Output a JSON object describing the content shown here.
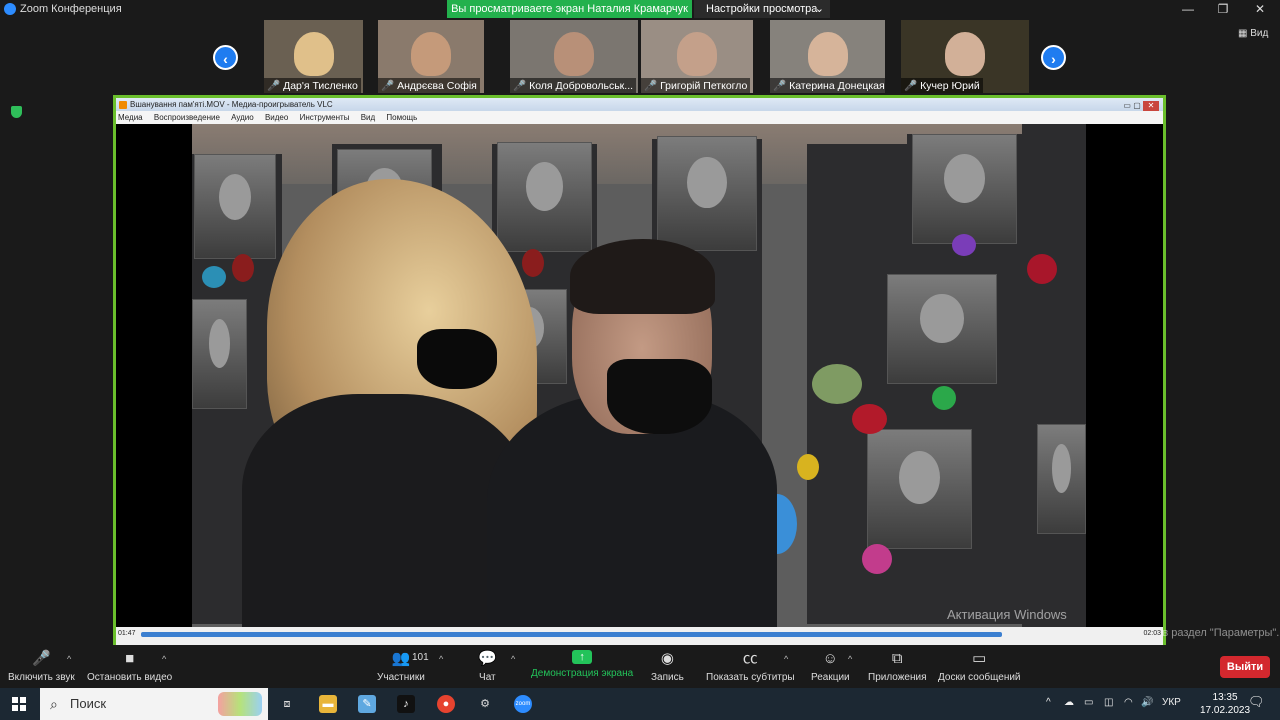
{
  "window": {
    "app_title": "Zoom Конференция"
  },
  "share_banner": "Вы просматриваете экран Наталия Крамарчук",
  "view_settings": "Настройки просмотра",
  "view_button": "Вид",
  "participants": [
    {
      "name": "Дар'я Тисленко"
    },
    {
      "name": "Андрєєва Софія"
    },
    {
      "name": "Коля Добровольськ..."
    },
    {
      "name": "Григорій Петкогло"
    },
    {
      "name": "Катерина Донецкая"
    },
    {
      "name": "Кучер Юрий"
    }
  ],
  "vlc": {
    "title": "Вшанування пам'яті.MOV - Медиа-проигрыватель VLC",
    "menu": [
      "Медиа",
      "Воспроизведение",
      "Аудио",
      "Видео",
      "Инструменты",
      "Вид",
      "Помощь"
    ],
    "time_elapsed": "01:47",
    "time_total": "02:03",
    "progress": 0.87
  },
  "windows_watermark": {
    "line1": "Активация Windows",
    "line2": "Чтобы активировать Windows, перейдите в раздел \"Параметры\"."
  },
  "toolbar": {
    "mute": "Включить звук",
    "video": "Остановить видео",
    "participants": "Участники",
    "participants_count": "101",
    "chat": "Чат",
    "share": "Демонстрация экрана",
    "record": "Запись",
    "subtitles": "Показать субтитры",
    "reactions": "Реакции",
    "apps": "Приложения",
    "whiteboards": "Доски сообщений",
    "exit": "Выйти"
  },
  "taskbar": {
    "search_placeholder": "Поиск",
    "language": "УКР",
    "time": "13:35",
    "date": "17.02.2023"
  },
  "colors": {
    "share_green": "#23b14d",
    "share_border": "#6abf2c",
    "exit_red": "#d3282e",
    "nav_blue": "#1f7cf0"
  }
}
